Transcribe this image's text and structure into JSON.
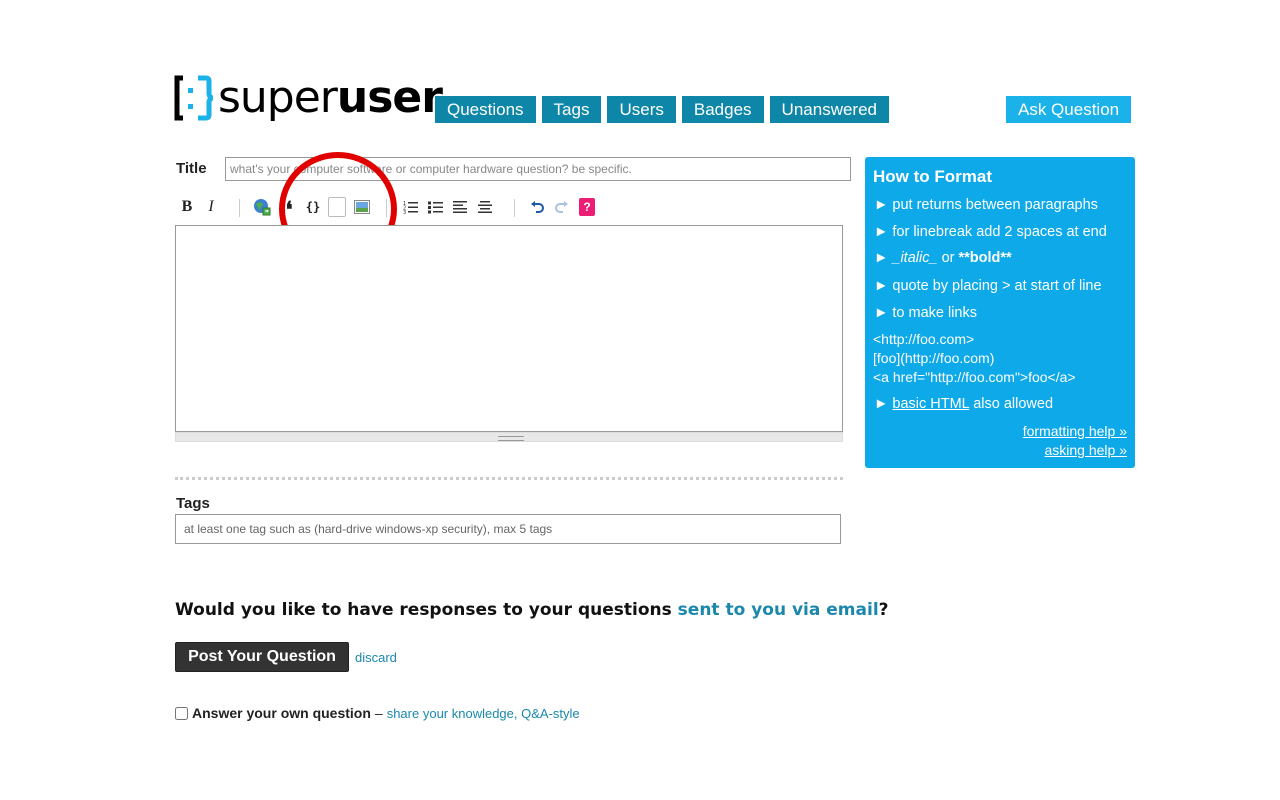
{
  "logo": {
    "text_light": "super",
    "text_bold": "user"
  },
  "nav": {
    "items": [
      "Questions",
      "Tags",
      "Users",
      "Badges",
      "Unanswered"
    ],
    "ask_label": "Ask Question"
  },
  "form": {
    "title_label": "Title",
    "title_placeholder": "what's your computer software or computer hardware question? be specific.",
    "tags_label": "Tags",
    "tags_placeholder": "at least one tag such as (hard-drive windows-xp security), max 5 tags"
  },
  "toolbar": {
    "bold": "B",
    "italic": "I",
    "code": "{}",
    "help": "?"
  },
  "email": {
    "question": "Would you like to have responses to your questions",
    "link": "sent to you via email",
    "suffix": "?"
  },
  "actions": {
    "post_label": "Post Your Question",
    "discard_label": "discard",
    "answer_own_label": "Answer your own question",
    "answer_own_dash": "–",
    "answer_own_link": "share your knowledge, Q&A-style"
  },
  "help_panel": {
    "title": "How to Format",
    "items": [
      "► put returns between paragraphs",
      "► for linebreak add 2 spaces at end",
      "► quote by placing > at start of line",
      "► to make links"
    ],
    "italic_item": {
      "bullet": "►",
      "italic": "_italic_",
      "or": "or",
      "bold": "**bold**"
    },
    "code_lines": [
      "<http://foo.com>",
      "[foo](http://foo.com)",
      "<a href=\"http://foo.com\">foo</a>"
    ],
    "html_item": {
      "bullet": "►",
      "link": "basic HTML",
      "suffix": "also allowed"
    },
    "formatting_help": "formatting help »",
    "asking_help": "asking help »"
  },
  "colors": {
    "nav_bg": "#0e86a8",
    "ask_bg": "#1ab2e8",
    "help_bg": "#0ea9e8",
    "link": "#1b88ab",
    "annotation": "#e00000"
  }
}
